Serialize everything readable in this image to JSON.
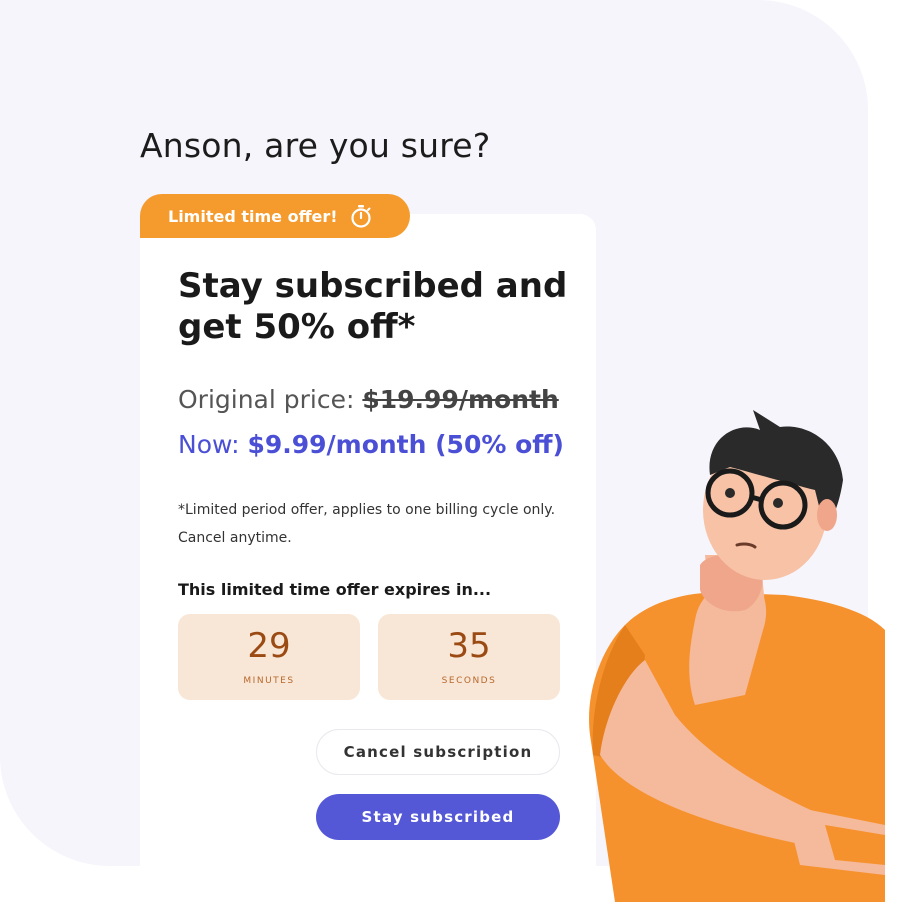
{
  "heading": "Anson, are you sure?",
  "offer_tag": {
    "label": "Limited time offer!",
    "icon": "stopwatch-icon",
    "color": "#f59a2c"
  },
  "offer": {
    "title": "Stay subscribed and get 50% off*",
    "original_prefix": "Original price:",
    "original_price": "$19.99/month",
    "now_prefix": "Now:",
    "now_price": "$9.99/month (50% off)",
    "fine_print": "*Limited period offer, applies to one billing cycle only. Cancel anytime.",
    "expires_label": "This limited time offer expires in..."
  },
  "countdown": {
    "minutes_value": "29",
    "minutes_label": "MINUTES",
    "seconds_value": "35",
    "seconds_label": "SECONDS"
  },
  "actions": {
    "cancel_label": "Cancel subscription",
    "stay_label": "Stay subscribed"
  },
  "colors": {
    "accent": "#5458d6",
    "offer_orange": "#f59a2c",
    "countdown_bg": "#f8e6d6",
    "background": "#f5f5fb"
  },
  "illustration": "thinking-man-illustration"
}
